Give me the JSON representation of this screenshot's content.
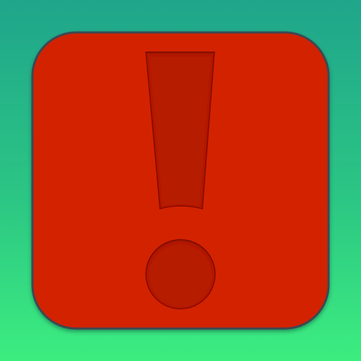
{
  "icon": {
    "name": "exclamation-warning-icon",
    "colors": {
      "background_top": "#1fa58b",
      "background_bottom": "#3ced7f",
      "tile_fill": "#d32100",
      "tile_border": "#3a4a52",
      "glyph_fill": "#b61a00",
      "glyph_shadow": "#7a1200"
    }
  }
}
